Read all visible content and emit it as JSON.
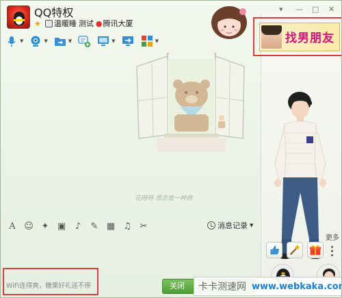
{
  "header": {
    "name": "QQ特权",
    "status_items": [
      "温暖睡",
      "测试",
      "腾讯大厦"
    ]
  },
  "window_controls": [
    "▾",
    "—",
    "□",
    "✕"
  ],
  "toolbar": {
    "items": [
      "voice-icon",
      "video-icon",
      "file-transfer-icon",
      "message-add-icon",
      "screen-share-icon",
      "remote-icon",
      "apps-icon"
    ]
  },
  "chat": {
    "caption": "花呀呀-思念是一种病"
  },
  "input_toolbar": {
    "icons": [
      "font-icon",
      "emoji-icon",
      "magic-icon",
      "shake-icon",
      "voice-input-icon",
      "edit-icon",
      "image-icon",
      "music-icon",
      "screenshot-icon"
    ],
    "message_record": "消息记录"
  },
  "input": {
    "ad_text": "WiFi连得爽，糖果好礼送不停"
  },
  "buttons": {
    "close": "关闭(C)"
  },
  "right_panel": {
    "ad_banner_text": "找男朋友",
    "more_label": "更多"
  },
  "watermark": {
    "text": "卡卡测速网",
    "url": "www.webkaka.com"
  },
  "colors": {
    "accent_green": "#5aa843",
    "highlight_red": "#e23b3b",
    "ad_pink": "#d4147b"
  }
}
